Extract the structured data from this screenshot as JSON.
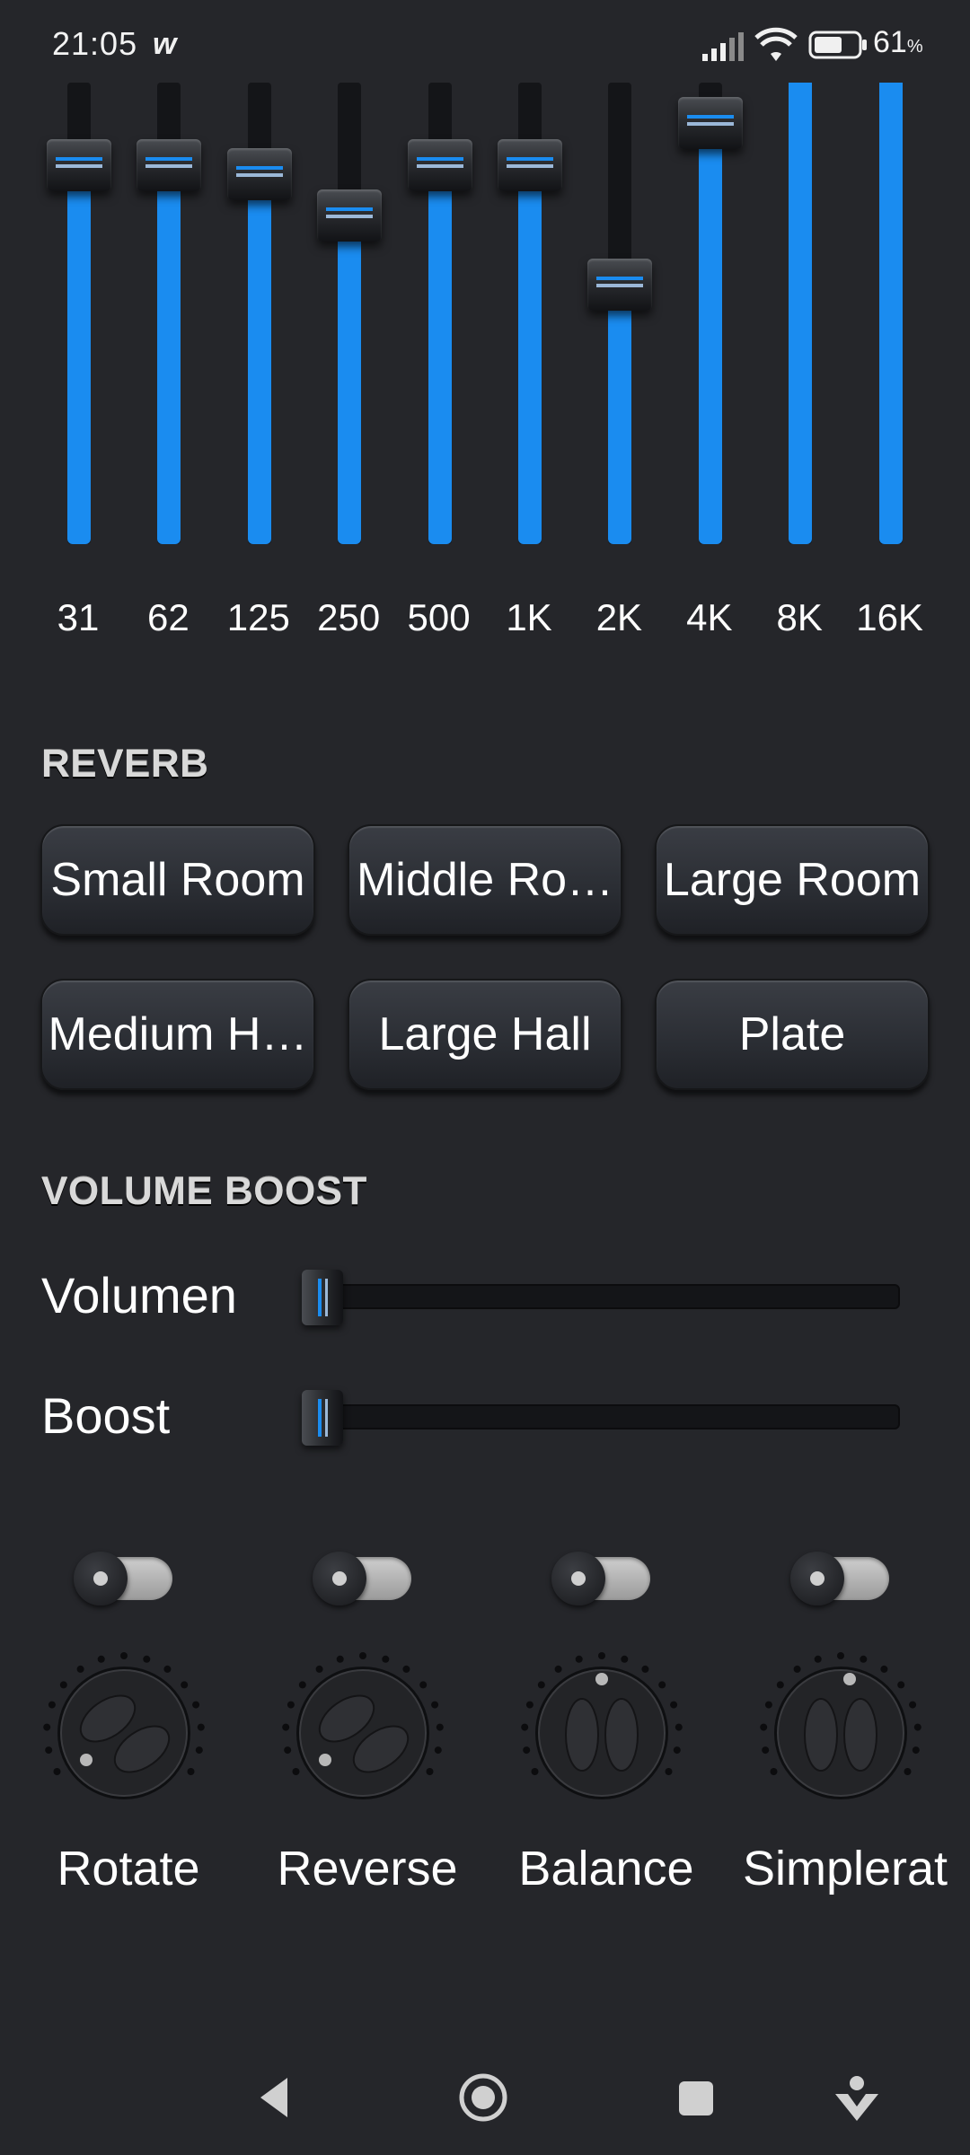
{
  "status_bar": {
    "time": "21:05",
    "app_icon": "w",
    "battery_level": "61",
    "battery_unit": "%",
    "icons": [
      "signal-icon",
      "wifi-icon",
      "battery-icon"
    ]
  },
  "equalizer": {
    "bands": [
      {
        "label": "31",
        "level": 0.82
      },
      {
        "label": "62",
        "level": 0.82
      },
      {
        "label": "125",
        "level": 0.8
      },
      {
        "label": "250",
        "level": 0.71
      },
      {
        "label": "500",
        "level": 0.82
      },
      {
        "label": "1K",
        "level": 0.82
      },
      {
        "label": "2K",
        "level": 0.56
      },
      {
        "label": "4K",
        "level": 0.91
      },
      {
        "label": "8K",
        "level": 1.0
      },
      {
        "label": "16K",
        "level": 1.0
      }
    ],
    "accent_color": "#1a8cf0"
  },
  "reverb": {
    "title": "REVERB",
    "buttons": [
      "Small Room",
      "Middle Ro…",
      "Large Room",
      "Medium H…",
      "Large Hall",
      "Plate"
    ]
  },
  "volume_boost": {
    "title": "VOLUME BOOST",
    "sliders": [
      {
        "label": "Volumen",
        "level": 0.0
      },
      {
        "label": "Boost",
        "level": 0.0
      }
    ]
  },
  "effects": [
    {
      "label": "Rotate",
      "enabled": false,
      "icon": "rotate-knob"
    },
    {
      "label": "Reverse",
      "enabled": false,
      "icon": "reverse-knob"
    },
    {
      "label": "Balance",
      "enabled": false,
      "icon": "balance-knob"
    },
    {
      "label": "Simplerat",
      "enabled": false,
      "icon": "simplerate-knob"
    }
  ],
  "nav": {
    "icons": [
      "back-icon",
      "home-icon",
      "recents-icon",
      "accessibility-icon"
    ]
  }
}
